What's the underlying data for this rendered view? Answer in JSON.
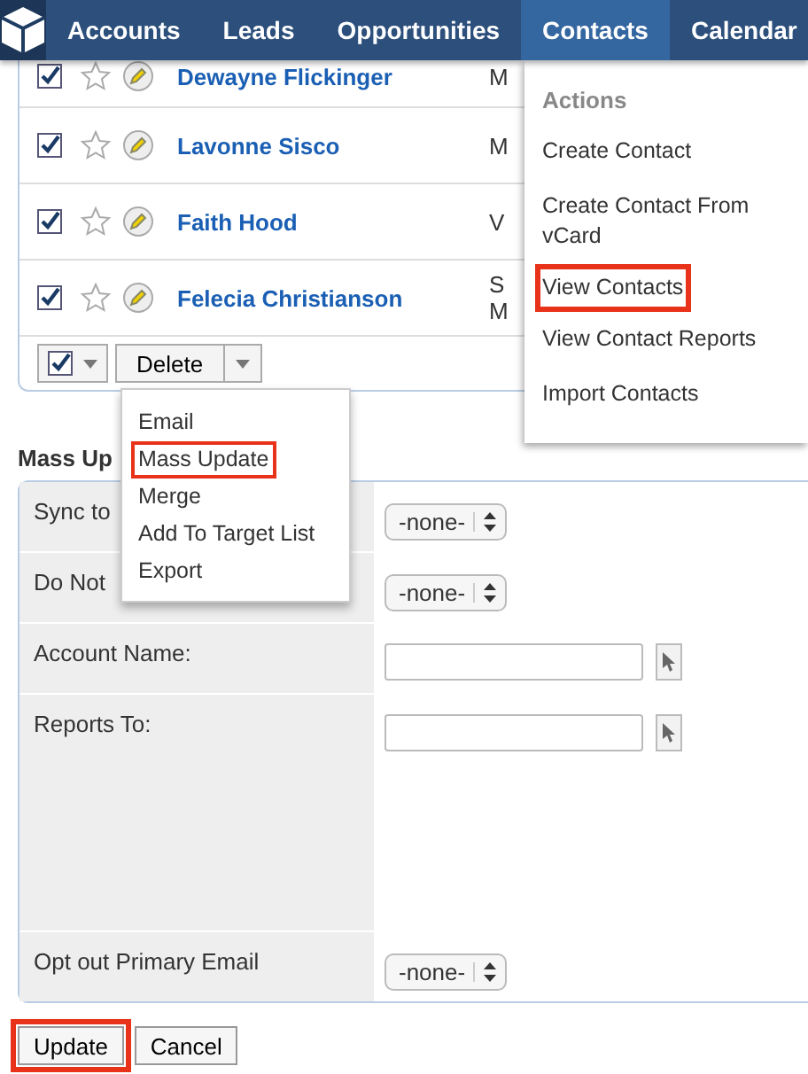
{
  "nav": {
    "items": [
      {
        "label": "Accounts",
        "selected": false
      },
      {
        "label": "Leads",
        "selected": false
      },
      {
        "label": "Opportunities",
        "selected": false
      },
      {
        "label": "Contacts",
        "selected": true
      },
      {
        "label": "Calendar",
        "selected": false
      }
    ]
  },
  "rows": [
    {
      "checked": true,
      "starred": false,
      "name": "Dewayne Flickinger",
      "col_2": [
        "M"
      ]
    },
    {
      "checked": true,
      "starred": false,
      "name": "Lavonne Sisco",
      "col_2": [
        "M"
      ]
    },
    {
      "checked": true,
      "starred": false,
      "name": "Faith Hood",
      "col_2": [
        "V"
      ]
    },
    {
      "checked": true,
      "starred": false,
      "name": "Felecia Christianson",
      "col_2": [
        "S",
        "M"
      ]
    }
  ],
  "action_bar": {
    "select_checked": true,
    "delete_label": "Delete"
  },
  "actions_menu": {
    "items": [
      {
        "label": "Email",
        "highlighted": false
      },
      {
        "label": "Mass Update",
        "highlighted": true
      },
      {
        "label": "Merge",
        "highlighted": false
      },
      {
        "label": "Add To Target List",
        "highlighted": false
      },
      {
        "label": "Export",
        "highlighted": false
      }
    ]
  },
  "contacts_menu": {
    "heading": "Actions",
    "items": [
      {
        "label": "Create Contact",
        "highlighted": false
      },
      {
        "label": "Create Contact From vCard",
        "highlighted": false
      },
      {
        "label": "View Contacts",
        "highlighted": true
      },
      {
        "label": "View Contact Reports",
        "highlighted": false
      },
      {
        "label": "Import Contacts",
        "highlighted": false
      }
    ]
  },
  "mass_update": {
    "heading": "Mass Up",
    "fields": [
      {
        "label": "Sync to",
        "kind": "select",
        "value": "-none-"
      },
      {
        "label": "Do Not",
        "kind": "select",
        "value": "-none-"
      },
      {
        "label": "Account Name:",
        "kind": "lookup"
      },
      {
        "label": "Reports To:",
        "kind": "lookup",
        "tall": true
      },
      {
        "label": "Opt out Primary Email",
        "kind": "select",
        "value": "-none-"
      }
    ]
  },
  "buttons": [
    {
      "label": "Update",
      "highlighted": true
    },
    {
      "label": "Cancel",
      "highlighted": false
    }
  ]
}
